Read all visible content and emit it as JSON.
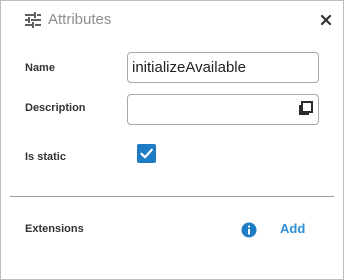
{
  "panel": {
    "title": "Attributes",
    "header_icon": "sliders-icon",
    "close_icon": "close-icon"
  },
  "fields": {
    "name_label": "Name",
    "name_value": "initializeAvailable",
    "description_label": "Description",
    "description_value": "",
    "description_icon": "expand-editor-icon",
    "is_static_label": "Is static",
    "is_static_checked": true
  },
  "extensions": {
    "label": "Extensions",
    "info_icon": "info-icon",
    "add_label": "Add"
  },
  "colors": {
    "accent": "#1e7cc4",
    "link": "#2d8fd5",
    "title_gray": "#8e8e8e"
  }
}
